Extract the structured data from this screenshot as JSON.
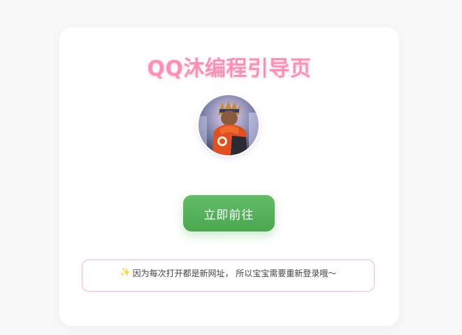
{
  "page": {
    "title": "QQ沐编程引导页"
  },
  "avatar": {
    "icon": "anime-character-avatar"
  },
  "actions": {
    "go_label": "立即前往"
  },
  "notice": {
    "icon": "sparkles-emoji",
    "icon_glyph": "✨",
    "text": "因为每次打开都是新网址， 所以宝宝需要重新登录哦～"
  },
  "colors": {
    "background": "#f8f8f8",
    "card": "#ffffff",
    "title": "#ff8fb4",
    "button": "#4caf50",
    "notice_border": "#f7b8cc"
  }
}
